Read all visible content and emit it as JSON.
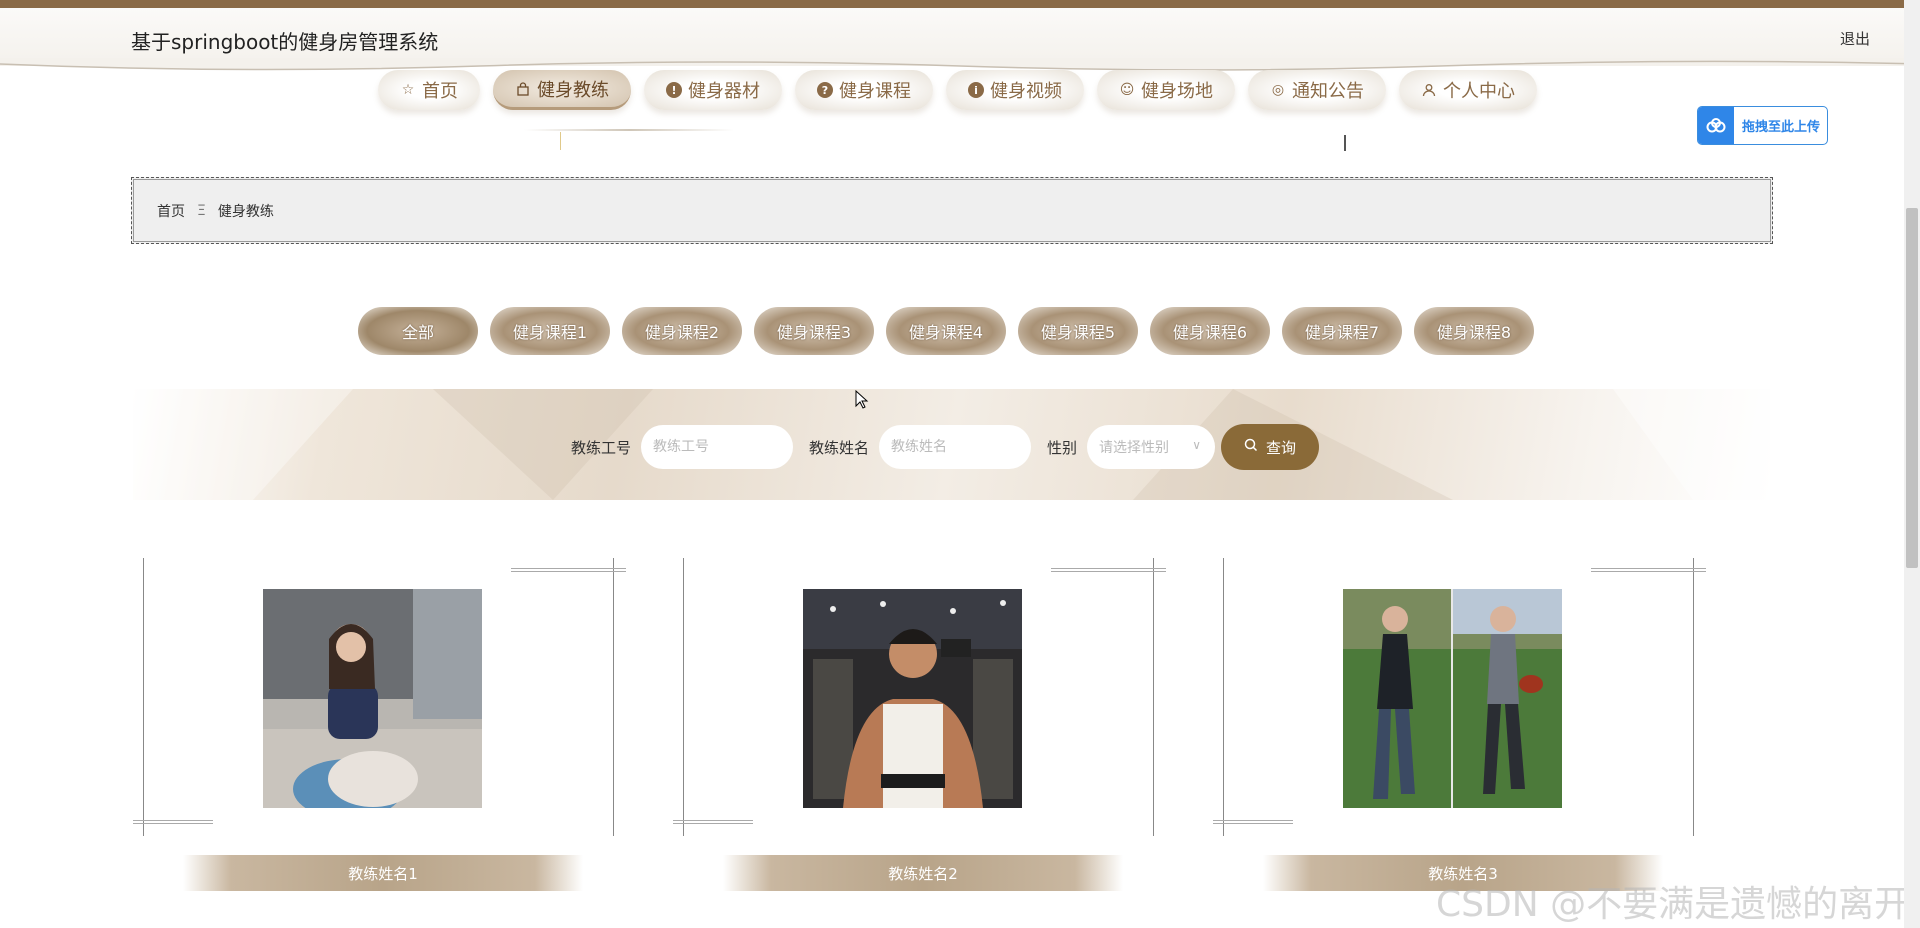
{
  "header": {
    "site_title": "基于springboot的健身房管理系统",
    "logout_label": "退出"
  },
  "nav": {
    "items": [
      {
        "label": "首页",
        "icon": "star-icon",
        "active": false
      },
      {
        "label": "健身教练",
        "icon": "bag-icon",
        "active": true
      },
      {
        "label": "健身器材",
        "icon": "info-circle-icon",
        "active": false
      },
      {
        "label": "健身课程",
        "icon": "question-circle-icon",
        "active": false
      },
      {
        "label": "健身视频",
        "icon": "info-circle-icon",
        "active": false
      },
      {
        "label": "健身场地",
        "icon": "face-icon",
        "active": false
      },
      {
        "label": "通知公告",
        "icon": "check-circle-icon",
        "active": false
      },
      {
        "label": "个人中心",
        "icon": "user-icon",
        "active": false
      }
    ]
  },
  "upload_button": {
    "label": "拖拽至此上传",
    "accent": "#2f86e8"
  },
  "breadcrumb": {
    "home": "首页",
    "separator": "Ξ",
    "current": "健身教练"
  },
  "categories": [
    "全部",
    "健身课程1",
    "健身课程2",
    "健身课程3",
    "健身课程4",
    "健身课程5",
    "健身课程6",
    "健身课程7",
    "健身课程8"
  ],
  "search": {
    "coach_no_label": "教练工号",
    "coach_no_placeholder": "教练工号",
    "coach_name_label": "教练姓名",
    "coach_name_placeholder": "教练姓名",
    "gender_label": "性别",
    "gender_placeholder": "请选择性别",
    "submit_label": "查询",
    "accent": "#8a6a38"
  },
  "cards": [
    {
      "name": "教练姓名1"
    },
    {
      "name": "教练姓名2"
    },
    {
      "name": "教练姓名3"
    }
  ],
  "watermark": "CSDN @不要满是遗憾的离开"
}
